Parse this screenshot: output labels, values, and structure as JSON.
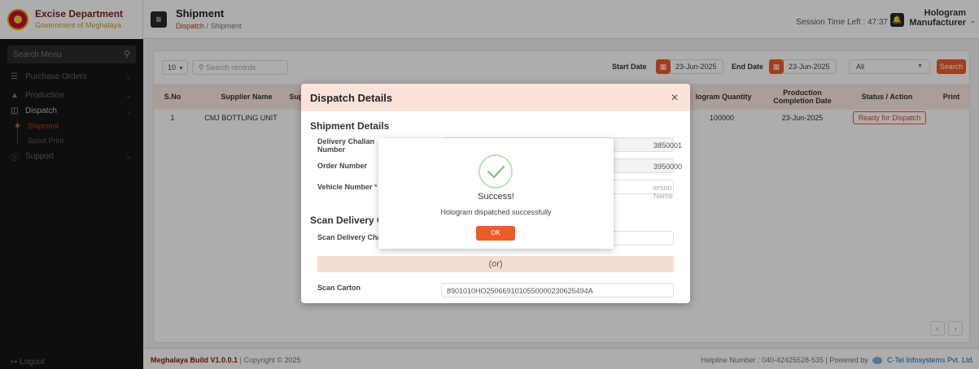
{
  "brand": {
    "title": "Excise Department",
    "subtitle": "Government of Meghalaya"
  },
  "sidebar": {
    "search_placeholder": "Search Menu",
    "items": [
      {
        "label": "Purchase Orders",
        "icon": "list-icon"
      },
      {
        "label": "Production",
        "icon": "triangle-icon"
      },
      {
        "label": "Dispatch",
        "icon": "ticket-icon"
      },
      {
        "label": "Support",
        "icon": "help-icon"
      }
    ],
    "dispatch_sub": [
      "Shipment",
      "Spool Print"
    ],
    "logout": "Logout"
  },
  "header": {
    "title": "Shipment",
    "breadcrumb_parent": "Dispatch",
    "breadcrumb_sep": "/",
    "breadcrumb_current": "Shipment",
    "session": "Session Time Left : 47:37",
    "user_line1": "Hologram",
    "user_line2": "Manufacturer"
  },
  "toolbar": {
    "page_size": "10",
    "search_placeholder": "Search records",
    "start_label": "Start Date",
    "start_value": "23-Jun-2025",
    "end_label": "End Date",
    "end_value": "23-Jun-2025",
    "status_value": "All",
    "search_button": "Search"
  },
  "table": {
    "headers": [
      "S.No",
      "Supplier Name",
      "Sup",
      "logram Quantity",
      "Production Completion Date",
      "Status / Action",
      "Print"
    ],
    "rows": [
      {
        "sno": "1",
        "supplier": "CMJ BOTTLING UNIT",
        "quantity": "100000",
        "date": "23-Jun-2025",
        "status": "Ready for Dispatch"
      }
    ]
  },
  "modal": {
    "title": "Dispatch Details",
    "section1": "Shipment Details",
    "challan_label": "Delivery Challan Number",
    "challan_value": "3850001",
    "order_label": "Order Number",
    "order_value": "3950000",
    "vehicle_label": "Vehicle Number",
    "vehicle_required": "*",
    "person_placeholder": "erson Name",
    "section2": "Scan Delivery C",
    "scan_challan_label": "Scan Delivery Cha",
    "or_text": "(or)",
    "scan_carton_label": "Scan Carton",
    "scan_carton_value": "8901010HO2506691010550000230625494A"
  },
  "alert": {
    "title": "Success!",
    "message": "Hologram dispatched successfully",
    "ok": "OK"
  },
  "footer": {
    "build": "Meghalaya Build V1.0.0.1",
    "copyright": "| Copyright © 2025",
    "helpline": "Helpline Number : 040-42425528-535",
    "powered": "| Powered by",
    "company": "C-Tel Infosystems Pvt. Ltd."
  },
  "colors": {
    "accent": "#f05a28",
    "sidebar_bg": "#151515",
    "brand_red": "#8b1a1a",
    "success_green": "#7cc576"
  }
}
